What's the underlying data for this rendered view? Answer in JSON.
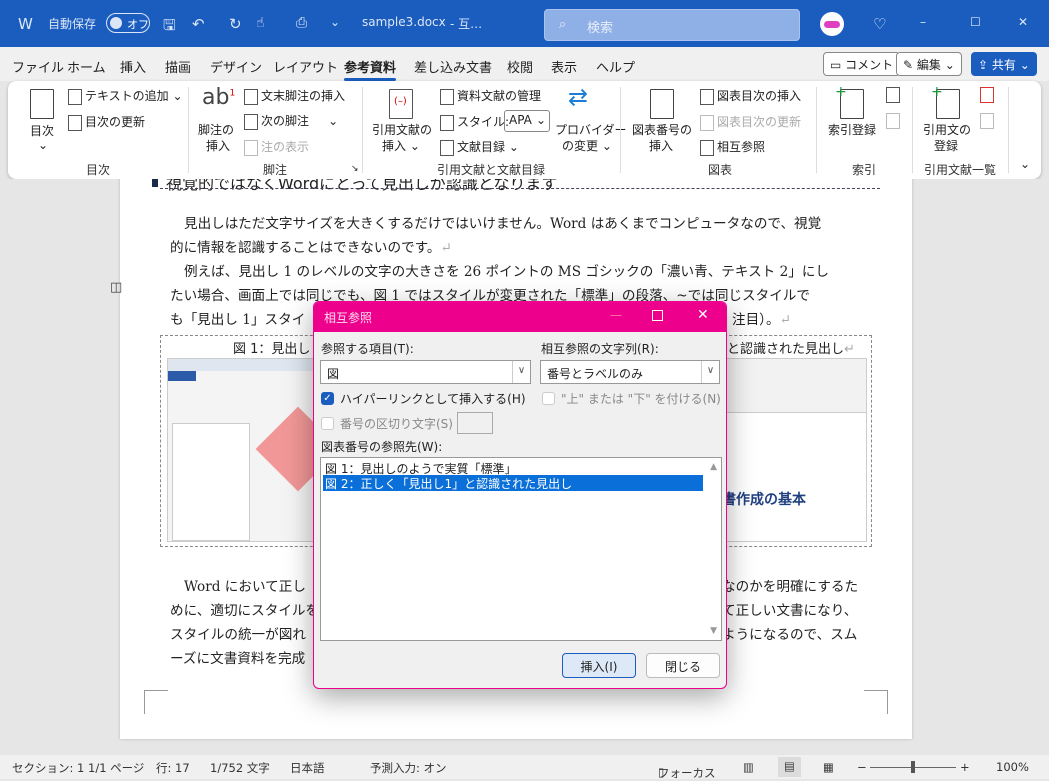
{
  "titlebar": {
    "autosave_label": "自動保存",
    "autosave_state": "オフ",
    "filename": "sample3.docx",
    "filename_suffix": "- 互…",
    "search_placeholder": "検索",
    "minimize": "–",
    "maximize": "☐",
    "close": "✕",
    "colors": {
      "background": "#1b5dbf"
    }
  },
  "menu": {
    "tabs": [
      "ファイル",
      "ホーム",
      "挿入",
      "描画",
      "デザイン",
      "レイアウト",
      "参考資料",
      "差し込み文書",
      "校閲",
      "表示",
      "ヘルプ"
    ],
    "active": "参考資料",
    "comment": "コメント",
    "edit": "編集",
    "share": "共有"
  },
  "ribbon": {
    "toc": {
      "toc": "目次",
      "add_text": "テキストの追加",
      "update_toc": "目次の更新",
      "group": "目次"
    },
    "footnotes": {
      "insert_footnote_1": "脚注の",
      "insert_footnote_2": "挿入",
      "insert_endnote": "文末脚注の挿入",
      "next_footnote": "次の脚注",
      "show_notes": "注の表示",
      "group": "脚注"
    },
    "citations": {
      "insert_citation_1": "引用文献の",
      "insert_citation_2": "挿入",
      "manage_sources": "資料文献の管理",
      "style_label": "スタイル:",
      "style_value": "APA",
      "bibliography": "文献目録",
      "provider_1": "プロバイダー",
      "provider_2": "の変更",
      "group": "引用文献と文献目録"
    },
    "captions": {
      "insert_caption_1": "図表番号の",
      "insert_caption_2": "挿入",
      "insert_table_of_figures": "図表目次の挿入",
      "update_table": "図表目次の更新",
      "cross_reference": "相互参照",
      "group": "図表"
    },
    "index": {
      "mark_entry": "索引登録",
      "group": "索引"
    },
    "toa": {
      "mark_citation_1": "引用文の",
      "mark_citation_2": "登録",
      "group": "引用文献一覧"
    }
  },
  "document": {
    "heading": "視覚的ではなくWordにとって見出しが認識となります",
    "p1_l1": "見出しはただ文字サイズを大きくするだけではいけません。Word はあくまでコンピュータなので、視覚",
    "p1_l2": "的に情報を認識することはできないのです。",
    "p2_l1": "例えば、見出し 1 のレベルの文字の大きさを 26 ポイントの MS ゴシックの「濃い青、テキスト 2」にし",
    "p2_l2": "たい場合、画面上では同じでも、図 1 ではスタイルが変更された「標準」の段落、~では同じスタイルで",
    "p2_l3_left": "も「見出し 1」スタイ",
    "p2_l3_right": "注目）。",
    "caption_left": "図 1：見出し",
    "caption_right": "と認識された見出し",
    "fig2_heading": "書作成の基本",
    "p3_l1_left": "Word において正し",
    "p3_l1_right": "なのかを明確にするた",
    "p3_l2_left": "めに、適切にスタイルを",
    "p3_l2_right": "て正しい文書になり、",
    "p3_l3_left": "スタイルの統一が図れ",
    "p3_l3_right": "ようになるので、スム",
    "p3_l4_left": "ーズに文書資料を完成",
    "para_mark": "↵"
  },
  "dialog": {
    "title": "相互参照",
    "ref_type_label": "参照する項目(T):",
    "ref_type_value": "図",
    "ref_to_label": "相互参照の文字列(R):",
    "ref_to_value": "番号とラベルのみ",
    "hyperlink_label": "ハイパーリンクとして挿入する(H)",
    "hyperlink_checked": true,
    "above_below_label": "\"上\" または \"下\" を付ける(N)",
    "separator_label": "番号の区切り文字(S)",
    "list_label": "図表番号の参照先(W):",
    "items": [
      "図 1：見出しのようで実質「標準」",
      "図 2：正しく「見出し1」と認識された見出し"
    ],
    "selected_index": 1,
    "insert": "挿入(I)",
    "close": "閉じる",
    "colors": {
      "border": "#ec008c",
      "selection": "#0a6fd8"
    }
  },
  "status": {
    "section": "セクション: 1",
    "page": "1/1 ページ",
    "line": "行: 17",
    "words": "1/752 文字",
    "language": "日本語",
    "predictive": "予測入力: オン",
    "focus": "フォーカス",
    "zoom": "100%"
  }
}
